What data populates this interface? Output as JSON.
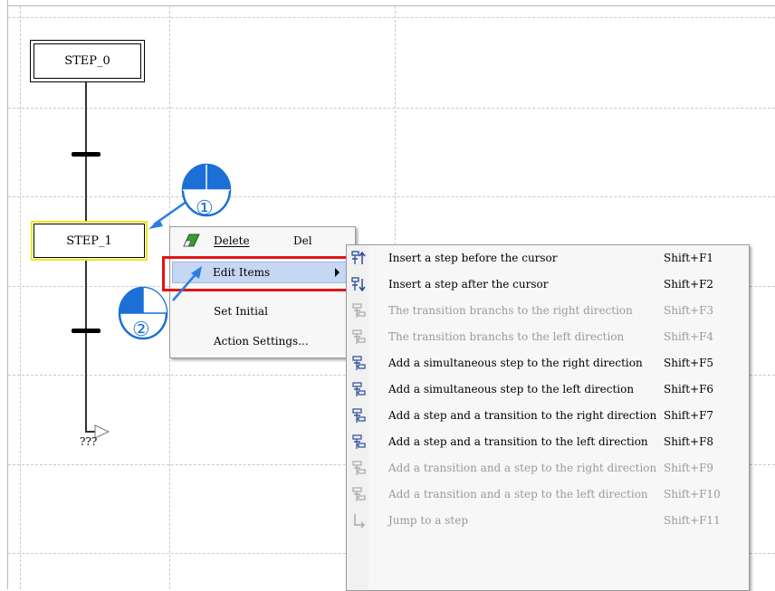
{
  "chart": {
    "steps": [
      {
        "label": "STEP_0"
      },
      {
        "label": "STEP_1"
      }
    ],
    "jump_label": "???"
  },
  "callouts": {
    "one": "①",
    "two": "②"
  },
  "context_menu": {
    "items": [
      {
        "label": "Delete",
        "shortcut": "Del",
        "icon": "eraser-icon"
      },
      {
        "label": "Edit Items",
        "icon": "none"
      },
      {
        "label": "Set Initial",
        "icon": "none"
      },
      {
        "label": "Action Settings...",
        "icon": "none"
      }
    ],
    "highlight_color": "#c6d7f3",
    "callout_border_color": "#e01515"
  },
  "submenu": {
    "items": [
      {
        "label": "Insert a step before the cursor",
        "shortcut": "Shift+F1",
        "enabled": true,
        "icon": "insert-step-before-icon"
      },
      {
        "label": "Insert a step after the cursor",
        "shortcut": "Shift+F2",
        "enabled": true,
        "icon": "insert-step-after-icon"
      },
      {
        "label": "The transition branchs to the right direction",
        "shortcut": "Shift+F3",
        "enabled": false,
        "icon": "transition-branch-right-icon"
      },
      {
        "label": "The transition branchs to the left direction",
        "shortcut": "Shift+F4",
        "enabled": false,
        "icon": "transition-branch-left-icon"
      },
      {
        "label": "Add a simultaneous step to the right direction",
        "shortcut": "Shift+F5",
        "enabled": true,
        "icon": "simultaneous-step-right-icon"
      },
      {
        "label": "Add a simultaneous step to the left direction",
        "shortcut": "Shift+F6",
        "enabled": true,
        "icon": "simultaneous-step-left-icon"
      },
      {
        "label": "Add a step and a transition to the right direction",
        "shortcut": "Shift+F7",
        "enabled": true,
        "icon": "step-transition-right-icon"
      },
      {
        "label": "Add a step and a transition to the left direction",
        "shortcut": "Shift+F8",
        "enabled": true,
        "icon": "step-transition-left-icon"
      },
      {
        "label": "Add a transition and a step to the right direction",
        "shortcut": "Shift+F9",
        "enabled": false,
        "icon": "transition-step-right-icon"
      },
      {
        "label": "Add a transition and a step to the left direction",
        "shortcut": "Shift+F10",
        "enabled": false,
        "icon": "transition-step-left-icon"
      },
      {
        "label": "Jump to a step",
        "shortcut": "Shift+F11",
        "enabled": false,
        "icon": "jump-to-step-icon"
      }
    ],
    "enabled_color": "#000000",
    "disabled_color": "#9a9a9a",
    "icon_color": "#2a4a9a"
  }
}
